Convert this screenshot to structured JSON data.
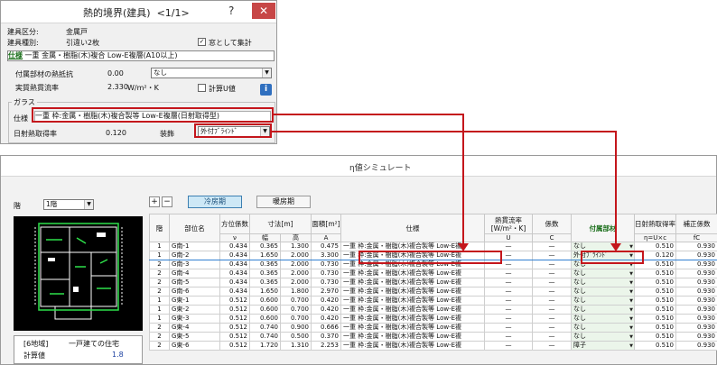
{
  "dialog": {
    "title": "熱的境界(建具)",
    "page": "<1/1>",
    "help": "?",
    "close": "✕",
    "type_label": "建具区分:",
    "type_value": "金属戸",
    "kind_label": "建具種別:",
    "kind_value": "引違い2枚",
    "window_check_label": "窓として集計",
    "window_checked": "✓",
    "spec_label": "仕様",
    "spec_value": "一重 金属・樹脂(木)複合 Low-E複層(A10以上)",
    "attach_thermal_label": "付属部材の熱抵抗",
    "attach_thermal_value": "0.00",
    "attach_select": "なし",
    "u_label": "実質熱貫流率",
    "u_value": "2.330",
    "u_unit": "W/m²・K",
    "calc_u_label": "計算U値",
    "info_icon": "i",
    "glass_group": "ガラス",
    "glass_spec_label": "仕様",
    "glass_spec_value": "一重 枠:金属・樹脂(木)複合製等 Low-E複層(日射取得型)",
    "solar_label": "日射熱取得率",
    "solar_value": "0.120",
    "deco_label": "装飾",
    "deco_select": "外付ﾌﾞﾗｲﾝﾄﾞ"
  },
  "sim": {
    "title": "η値シミュレート",
    "floor_label": "階",
    "floor_select": "1階",
    "plus": "+",
    "minus": "−",
    "tab_cool": "冷房期",
    "tab_warm": "暖房期",
    "region": "[6地域]",
    "house_type": "一戸建ての住宅",
    "calc_label": "計算値",
    "calc_value": "1.8"
  },
  "table": {
    "headers": {
      "floor": "階",
      "part": "部位名",
      "coef": "方位係数",
      "dim": "寸法[m]",
      "width": "幅",
      "height": "高",
      "area": "面積[m²]",
      "spec": "仕様",
      "u": "熱貫流率[W/m²・K]",
      "factor": "係数",
      "attach": "付属部材",
      "solar": "日射熱取得率",
      "corr": "補正係数"
    },
    "subheaders": {
      "coef": "ν",
      "area": "A",
      "u": "U",
      "factor": "C",
      "solar": "η=U×c",
      "corr": "fC"
    },
    "rows": [
      {
        "floor": "1",
        "part": "G南-1",
        "coef": "0.434",
        "w": "0.365",
        "h": "1.300",
        "a": "0.475",
        "spec": "一重 枠:金属・樹脂(木)複合製等 Low-E複",
        "u": "—",
        "c": "—",
        "attach": "なし",
        "eta": "0.510",
        "fc": "0.930"
      },
      {
        "floor": "1",
        "part": "G南-2",
        "coef": "0.434",
        "w": "1.650",
        "h": "2.000",
        "a": "3.300",
        "spec": "一重 枠:金属・樹脂(木)複合製等 Low-E複",
        "u": "—",
        "c": "—",
        "attach": "外付ﾌﾞﾗｲﾝﾄﾞ",
        "eta": "0.120",
        "fc": "0.930"
      },
      {
        "floor": "2",
        "part": "G南-3",
        "coef": "0.434",
        "w": "0.365",
        "h": "2.000",
        "a": "0.730",
        "spec": "一重 枠:金属・樹脂(木)複合製等 Low-E複",
        "u": "—",
        "c": "—",
        "attach": "なし",
        "eta": "0.510",
        "fc": "0.930"
      },
      {
        "floor": "2",
        "part": "G南-4",
        "coef": "0.434",
        "w": "0.365",
        "h": "2.000",
        "a": "0.730",
        "spec": "一重 枠:金属・樹脂(木)複合製等 Low-E複",
        "u": "—",
        "c": "—",
        "attach": "なし",
        "eta": "0.510",
        "fc": "0.930"
      },
      {
        "floor": "2",
        "part": "G南-5",
        "coef": "0.434",
        "w": "0.365",
        "h": "2.000",
        "a": "0.730",
        "spec": "一重 枠:金属・樹脂(木)複合製等 Low-E複",
        "u": "—",
        "c": "—",
        "attach": "なし",
        "eta": "0.510",
        "fc": "0.930"
      },
      {
        "floor": "2",
        "part": "G南-6",
        "coef": "0.434",
        "w": "1.650",
        "h": "1.800",
        "a": "2.970",
        "spec": "一重 枠:金属・樹脂(木)複合製等 Low-E複",
        "u": "—",
        "c": "—",
        "attach": "なし",
        "eta": "0.510",
        "fc": "0.930"
      },
      {
        "floor": "1",
        "part": "G東-1",
        "coef": "0.512",
        "w": "0.600",
        "h": "0.700",
        "a": "0.420",
        "spec": "一重 枠:金属・樹脂(木)複合製等 Low-E複",
        "u": "—",
        "c": "—",
        "attach": "なし",
        "eta": "0.510",
        "fc": "0.930"
      },
      {
        "floor": "1",
        "part": "G東-2",
        "coef": "0.512",
        "w": "0.600",
        "h": "0.700",
        "a": "0.420",
        "spec": "一重 枠:金属・樹脂(木)複合製等 Low-E複",
        "u": "—",
        "c": "—",
        "attach": "なし",
        "eta": "0.510",
        "fc": "0.930"
      },
      {
        "floor": "1",
        "part": "G東-3",
        "coef": "0.512",
        "w": "0.600",
        "h": "0.700",
        "a": "0.420",
        "spec": "一重 枠:金属・樹脂(木)複合製等 Low-E複",
        "u": "—",
        "c": "—",
        "attach": "なし",
        "eta": "0.510",
        "fc": "0.930"
      },
      {
        "floor": "2",
        "part": "G東-4",
        "coef": "0.512",
        "w": "0.740",
        "h": "0.900",
        "a": "0.666",
        "spec": "一重 枠:金属・樹脂(木)複合製等 Low-E複",
        "u": "—",
        "c": "—",
        "attach": "なし",
        "eta": "0.510",
        "fc": "0.930"
      },
      {
        "floor": "2",
        "part": "G東-5",
        "coef": "0.512",
        "w": "0.740",
        "h": "0.500",
        "a": "0.370",
        "spec": "一重 枠:金属・樹脂(木)複合製等 Low-E複",
        "u": "—",
        "c": "—",
        "attach": "なし",
        "eta": "0.510",
        "fc": "0.930"
      },
      {
        "floor": "2",
        "part": "G東-6",
        "coef": "0.512",
        "w": "1.720",
        "h": "1.310",
        "a": "2.253",
        "spec": "一重 枠:金属・樹脂(木)複合製等 Low-E複",
        "u": "—",
        "c": "—",
        "attach": "障子",
        "eta": "0.510",
        "fc": "0.930"
      }
    ]
  },
  "colors": {
    "highlight": "#c4161c",
    "plan_bg": "#000000",
    "plan_lines": "#ffffff",
    "plan_marks": "#2ee04a",
    "selected_row": "#2f7fd0"
  }
}
